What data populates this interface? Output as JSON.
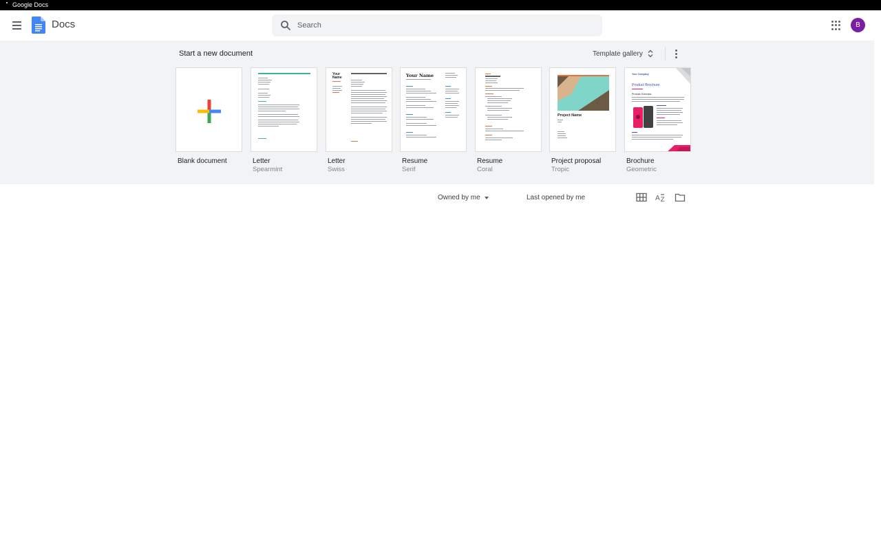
{
  "os": {
    "title": "Google Docs"
  },
  "header": {
    "app_title": "Docs",
    "search_placeholder": "Search",
    "avatar_initial": "B",
    "avatar_color": "#7b1fa2"
  },
  "templates": {
    "section_title": "Start a new document",
    "gallery_label": "Template gallery",
    "items": [
      {
        "name": "Blank document",
        "sub": ""
      },
      {
        "name": "Letter",
        "sub": "Spearmint"
      },
      {
        "name": "Letter",
        "sub": "Swiss"
      },
      {
        "name": "Resume",
        "sub": "Serif"
      },
      {
        "name": "Resume",
        "sub": "Coral"
      },
      {
        "name": "Project proposal",
        "sub": "Tropic"
      },
      {
        "name": "Brochure",
        "sub": "Geometric"
      }
    ],
    "thumb_text": {
      "your_name_swiss": "Your Name",
      "your_name_serif": "Your Name",
      "project_name": "Project Name",
      "your_company": "Your Company",
      "product_brochure": "Product Brochure",
      "product_overview": "Product Overview"
    }
  },
  "docs_list": {
    "owner_filter": "Owned by me",
    "sort_label": "Last opened by me"
  },
  "colors": {
    "accent_blue": "#4285f4",
    "accent_red": "#ea4335",
    "accent_yellow": "#fbbc04",
    "accent_green": "#34a853",
    "spearmint": "#3ab59a",
    "coral": "#e8703a",
    "brochure_pink": "#e91e63"
  }
}
